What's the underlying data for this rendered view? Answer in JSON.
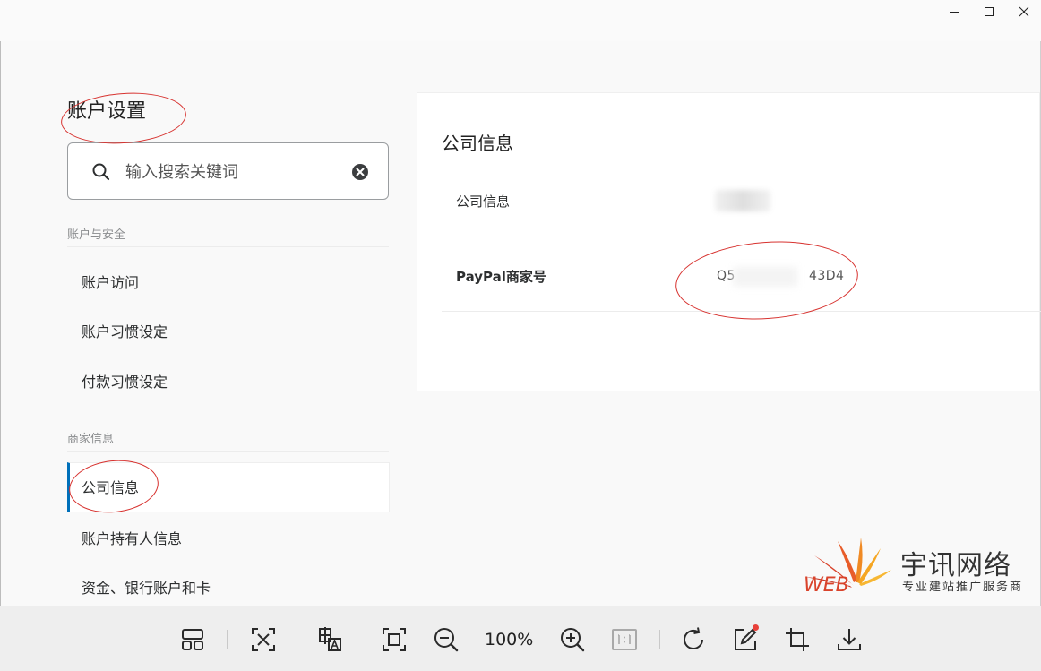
{
  "page": {
    "title": "账户设置"
  },
  "search": {
    "placeholder": "输入搜索关键词"
  },
  "sidebar": {
    "sections": [
      {
        "header": "账户与安全",
        "items": [
          {
            "label": "账户访问"
          },
          {
            "label": "账户习惯设定"
          },
          {
            "label": "付款习惯设定"
          }
        ]
      },
      {
        "header": "商家信息",
        "items": [
          {
            "label": "公司信息",
            "active": true
          },
          {
            "label": "账户持有人信息"
          },
          {
            "label": "资金、银行账户和卡"
          }
        ]
      }
    ]
  },
  "card": {
    "title": "公司信息",
    "rows": [
      {
        "label": "公司信息",
        "value": ""
      },
      {
        "label": "PayPal商家号",
        "value": "Q5"
      }
    ],
    "merchant_id_suffix": "43D4"
  },
  "toolbar": {
    "zoom": "100%"
  },
  "logo": {
    "mark": "WEB",
    "name": "宇讯网络",
    "tagline": "专业建站推广服务商"
  },
  "colors": {
    "accent": "#0070ba",
    "annotation": "#d7322f",
    "notify": "#e8413a"
  }
}
